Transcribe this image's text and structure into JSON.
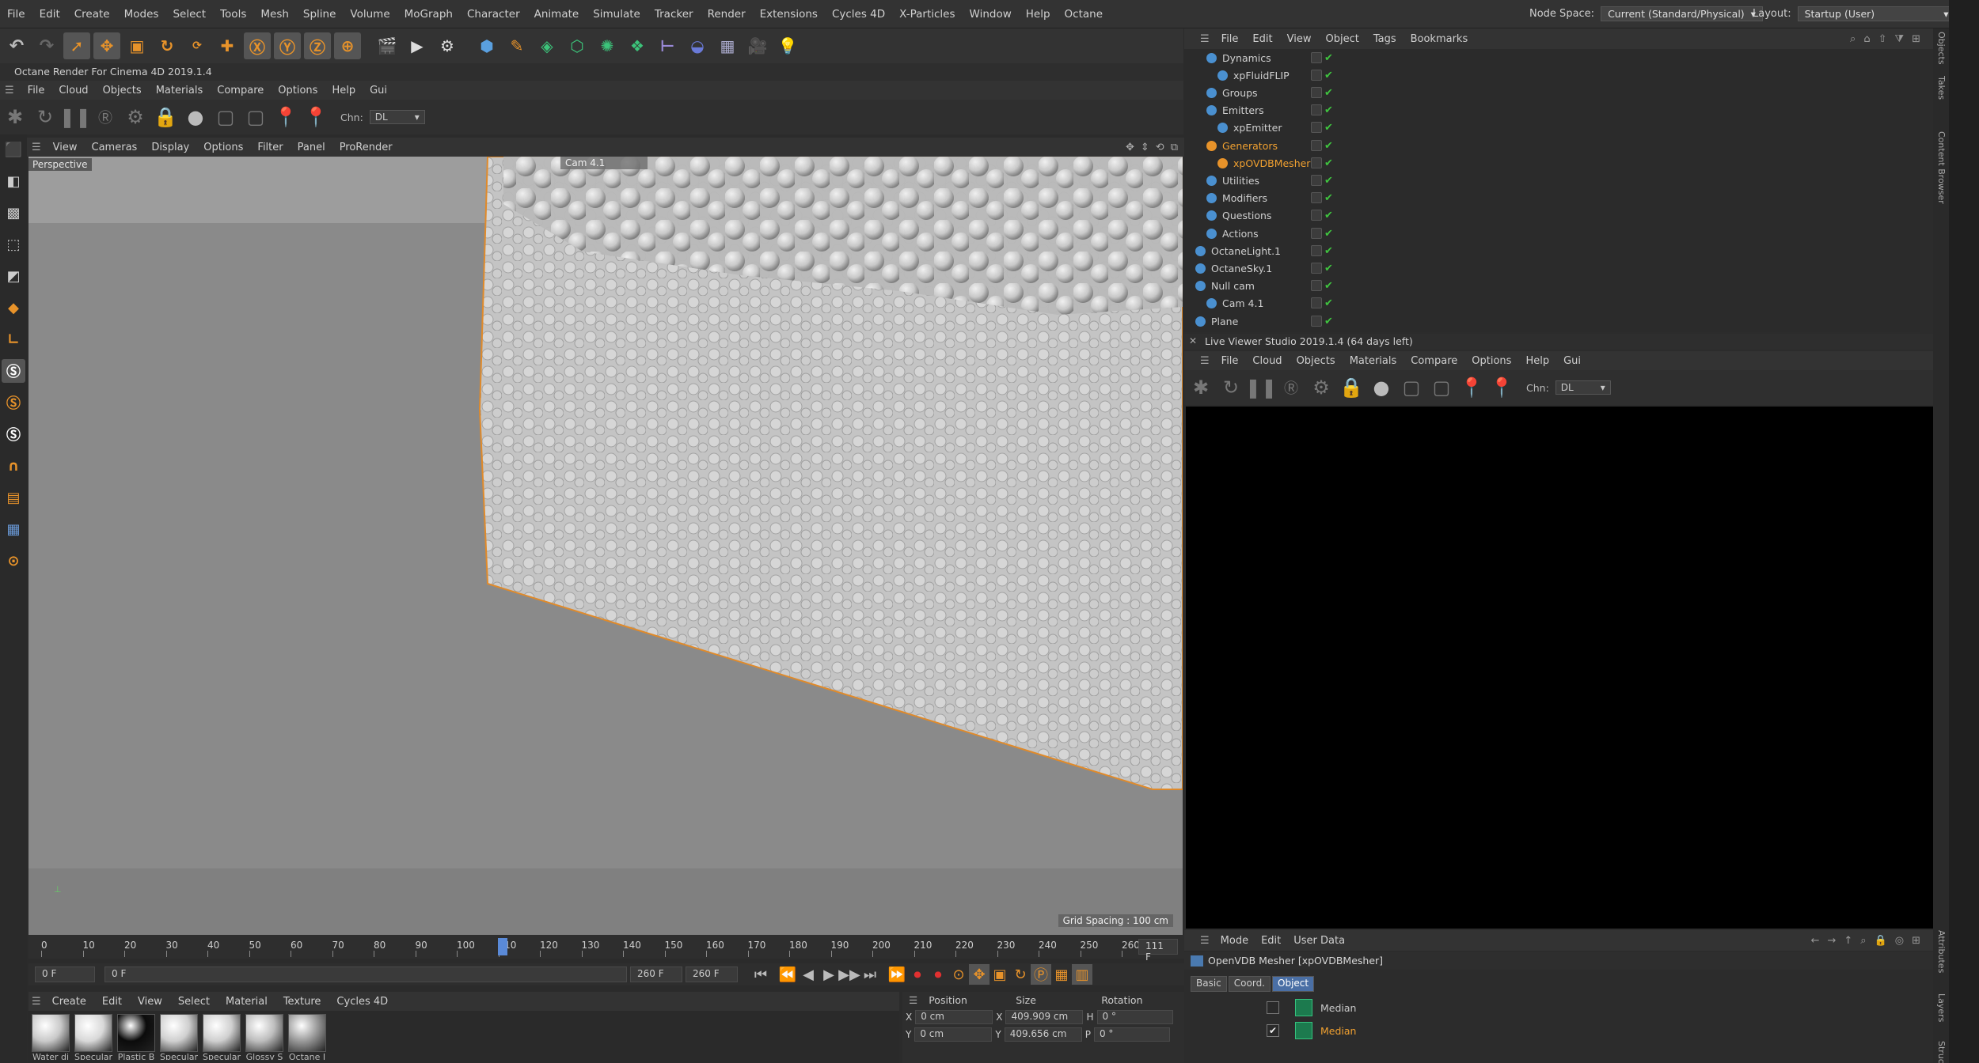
{
  "menubar": {
    "items": [
      "File",
      "Edit",
      "Create",
      "Modes",
      "Select",
      "Tools",
      "Mesh",
      "Spline",
      "Volume",
      "MoGraph",
      "Character",
      "Animate",
      "Simulate",
      "Tracker",
      "Render",
      "Extensions",
      "Cycles 4D",
      "X-Particles",
      "Window",
      "Help",
      "Octane"
    ],
    "node_space_label": "Node Space:",
    "node_space_value": "Current (Standard/Physical)",
    "layout_label": "Layout:",
    "layout_value": "Startup (User)"
  },
  "octane": {
    "title": "Octane Render For Cinema 4D 2019.1.4",
    "menu": [
      "File",
      "Cloud",
      "Objects",
      "Materials",
      "Compare",
      "Options",
      "Help",
      "Gui"
    ],
    "chn_label": "Chn:",
    "chn_value": "DL"
  },
  "viewport": {
    "menu": [
      "View",
      "Cameras",
      "Display",
      "Options",
      "Filter",
      "Panel",
      "ProRender"
    ],
    "view_name": "Perspective",
    "camera_label": "Cam 4.1",
    "grid_spacing": "Grid Spacing : 100 cm"
  },
  "timeline": {
    "ticks": [
      "0",
      "10",
      "20",
      "30",
      "40",
      "50",
      "60",
      "70",
      "80",
      "90",
      "100",
      "110",
      "120",
      "130",
      "140",
      "150",
      "160",
      "170",
      "180",
      "190",
      "200",
      "210",
      "220",
      "230",
      "240",
      "250",
      "260"
    ],
    "current_frame": "111",
    "current_frame_box": "111 F",
    "start_field": "0 F",
    "start_field2": "0 F",
    "end_field": "260 F",
    "end_field2": "260 F"
  },
  "materials": {
    "menu": [
      "Create",
      "Edit",
      "View",
      "Select",
      "Material",
      "Texture",
      "Cycles 4D"
    ],
    "items": [
      {
        "name": "Water di",
        "color": "#c9c9c9"
      },
      {
        "name": "Specular",
        "color": "#d8d8d8"
      },
      {
        "name": "Plastic B",
        "color": "#0b0b0b"
      },
      {
        "name": "Specular",
        "color": "#cfcfcf"
      },
      {
        "name": "Specular",
        "color": "#cfcfcf"
      },
      {
        "name": "Glossy S",
        "color": "#bdbdbd"
      },
      {
        "name": "Octane I",
        "color": "#9a9a9a"
      }
    ]
  },
  "coordinates": {
    "headers": [
      "Position",
      "Size",
      "Rotation"
    ],
    "rows": [
      {
        "axis": "X",
        "pos": "0 cm",
        "size_axis": "X",
        "size": "409.909 cm",
        "rot_axis": "H",
        "rot": "0 °"
      },
      {
        "axis": "Y",
        "pos": "0 cm",
        "size_axis": "Y",
        "size": "409.656 cm",
        "rot_axis": "P",
        "rot": "0 °"
      }
    ]
  },
  "objects": {
    "menu": [
      "File",
      "Edit",
      "View",
      "Object",
      "Tags",
      "Bookmarks"
    ],
    "rows": [
      {
        "name": "Dynamics",
        "indent": 1,
        "highlight": false
      },
      {
        "name": "xpFluidFLIP",
        "indent": 2,
        "highlight": false
      },
      {
        "name": "Groups",
        "indent": 1,
        "highlight": false
      },
      {
        "name": "Emitters",
        "indent": 1,
        "highlight": false
      },
      {
        "name": "xpEmitter",
        "indent": 2,
        "highlight": false
      },
      {
        "name": "Generators",
        "indent": 1,
        "highlight": true
      },
      {
        "name": "xpOVDBMesher",
        "indent": 2,
        "highlight": true
      },
      {
        "name": "Utilities",
        "indent": 1,
        "highlight": false
      },
      {
        "name": "Modifiers",
        "indent": 1,
        "highlight": false
      },
      {
        "name": "Questions",
        "indent": 1,
        "highlight": false
      },
      {
        "name": "Actions",
        "indent": 1,
        "highlight": false
      },
      {
        "name": "OctaneLight.1",
        "indent": 0,
        "highlight": false
      },
      {
        "name": "OctaneSky.1",
        "indent": 0,
        "highlight": false
      },
      {
        "name": "Null cam",
        "indent": 0,
        "highlight": false
      },
      {
        "name": "Cam 4.1",
        "indent": 1,
        "highlight": false
      },
      {
        "name": "Plane",
        "indent": 0,
        "highlight": false
      }
    ]
  },
  "live_viewer": {
    "title": "Live Viewer Studio 2019.1.4 (64 days left)",
    "menu": [
      "File",
      "Cloud",
      "Objects",
      "Materials",
      "Compare",
      "Options",
      "Help",
      "Gui"
    ],
    "chn_label": "Chn:",
    "chn_value": "DL"
  },
  "attributes": {
    "menu": [
      "Mode",
      "Edit",
      "User Data"
    ],
    "title": "OpenVDB Mesher [xpOVDBMesher]",
    "tabs": [
      "Basic",
      "Coord.",
      "Object"
    ],
    "active_tab": "Object",
    "rows": [
      {
        "label": "Median",
        "checked": false,
        "highlight": false
      },
      {
        "label": "Median",
        "checked": true,
        "highlight": true
      }
    ]
  },
  "side_tabs": [
    "Objects",
    "Takes",
    "Content Browser",
    "Attributes",
    "Layers",
    "Structure"
  ],
  "colors": {
    "accent_orange": "#e8932a",
    "highlight_text": "#f0a030",
    "check_green": "#3fc43f",
    "active_tab": "#4a6fa5"
  }
}
